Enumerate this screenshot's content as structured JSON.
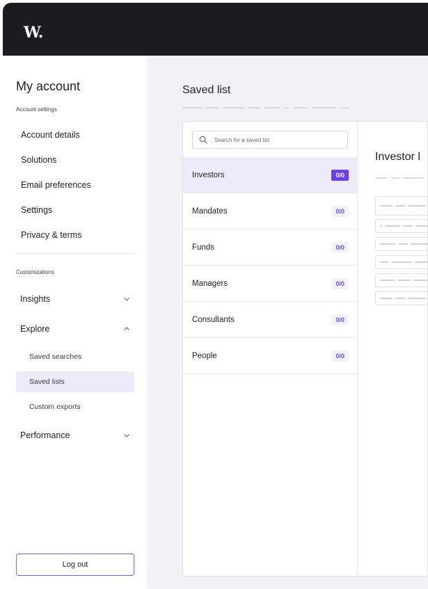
{
  "brand": {
    "logo": "W."
  },
  "sidebar": {
    "title": "My account",
    "account_settings_label": "Account settings",
    "account_items": [
      "Account details",
      "Solutions",
      "Email preferences",
      "Settings",
      "Privacy & terms"
    ],
    "customizations_label": "Customizations",
    "groups": {
      "insights": "Insights",
      "explore": "Explore",
      "performance": "Performance"
    },
    "explore_items": [
      "Saved searches",
      "Saved lists",
      "Custom exports"
    ],
    "active_explore_item": "Saved lists",
    "logout_label": "Log out"
  },
  "main": {
    "title": "Saved list",
    "search_placeholder": "Search for a saved list",
    "lists": [
      {
        "label": "Investors",
        "count": "0/0",
        "active": true
      },
      {
        "label": "Mandates",
        "count": "0/0",
        "active": false
      },
      {
        "label": "Funds",
        "count": "0/0",
        "active": false
      },
      {
        "label": "Managers",
        "count": "0/0",
        "active": false
      },
      {
        "label": "Consultants",
        "count": "0/0",
        "active": false
      },
      {
        "label": "People",
        "count": "0/0",
        "active": false
      }
    ],
    "detail_title": "Investor l"
  },
  "colors": {
    "accent": "#6d3fe6",
    "active_bg": "#ecebfa",
    "topbar": "#1c1c1e"
  }
}
